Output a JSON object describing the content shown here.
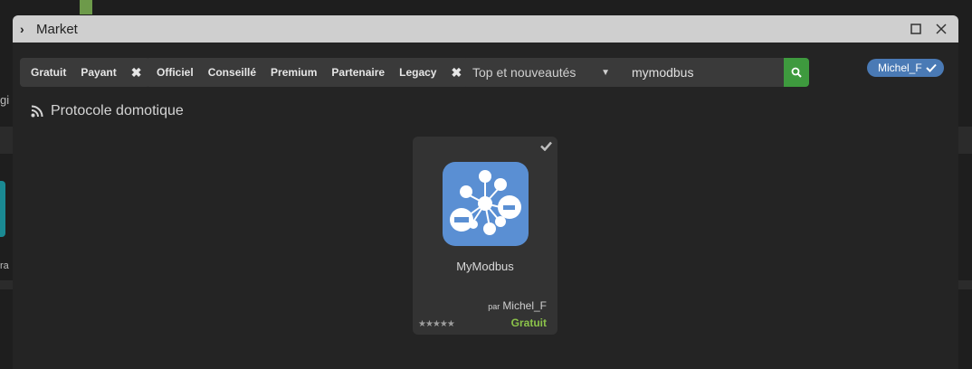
{
  "window": {
    "title": "Market"
  },
  "filters": {
    "price": [
      "Gratuit",
      "Payant"
    ],
    "certification": [
      "Officiel",
      "Conseillé",
      "Premium",
      "Partenaire",
      "Legacy"
    ]
  },
  "sort": {
    "value": "Top et nouveautés"
  },
  "search": {
    "value": "mymodbus"
  },
  "user": {
    "name": "Michel_F"
  },
  "section": {
    "title": "Protocole domotique"
  },
  "plugin": {
    "name": "MyModbus",
    "author_prefix": "par",
    "author": "Michel_F",
    "price": "Gratuit",
    "stars": "★★★★★",
    "rating": 5
  },
  "background": {
    "text_1": "gi",
    "text_2": "ra"
  },
  "colors": {
    "accent_green": "#3e9a3e",
    "badge_blue": "#4a7ab5",
    "icon_blue": "#5a8fd3",
    "price_green": "#8bc34a"
  }
}
